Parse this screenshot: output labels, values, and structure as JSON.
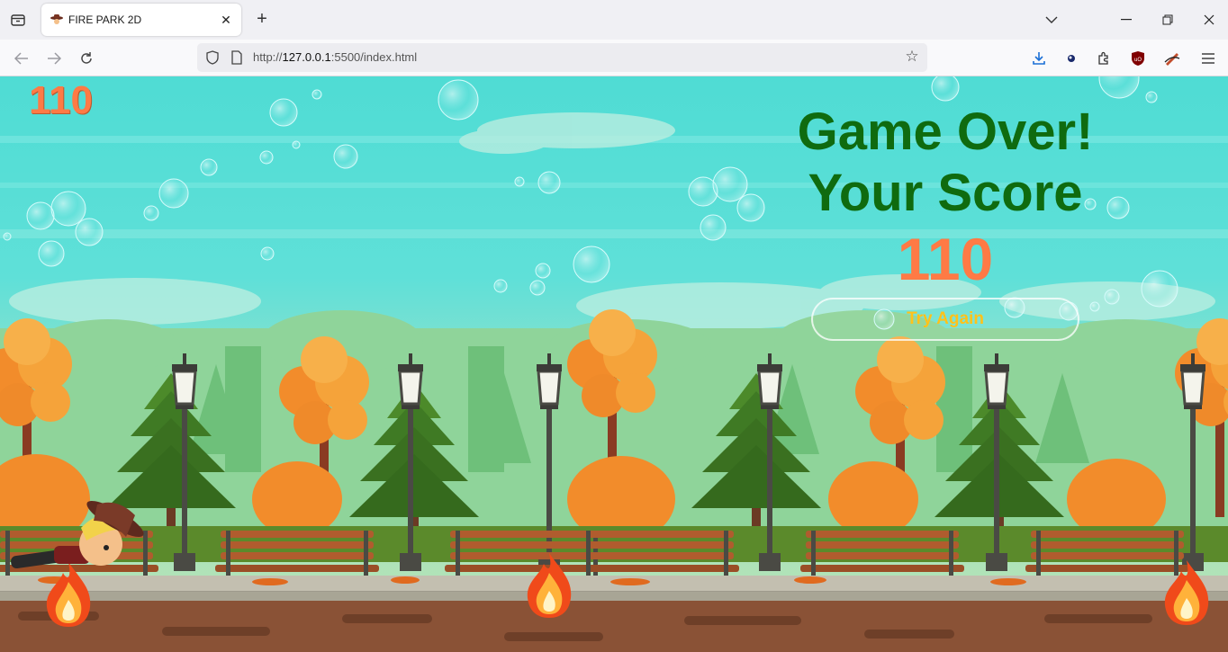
{
  "browser": {
    "tab": {
      "title": "FIRE PARK 2D",
      "favicon": "cowboy-favicon-icon"
    },
    "url": {
      "prefix": "http://",
      "host": "127.0.0.1",
      "rest": ":5500/index.html"
    },
    "icons": {
      "back": "arrow-left-icon",
      "forward": "arrow-right-icon",
      "reload": "reload-icon",
      "bookmark": "star-icon",
      "downloads": "download-icon",
      "extensions": "puzzle-icon",
      "menu": "hamburger-icon"
    }
  },
  "game": {
    "score": "110",
    "game_over": {
      "line1": "Game Over!",
      "line2": "Your Score",
      "score": "110",
      "button": "Try Again"
    },
    "colors": {
      "score": "#ff7a45",
      "title": "#0f6b0f",
      "button_text": "#ffc21a",
      "sky_top": "#4fdcd4",
      "sky_bottom": "#a8e0c0",
      "ground": "#8a5236"
    }
  }
}
